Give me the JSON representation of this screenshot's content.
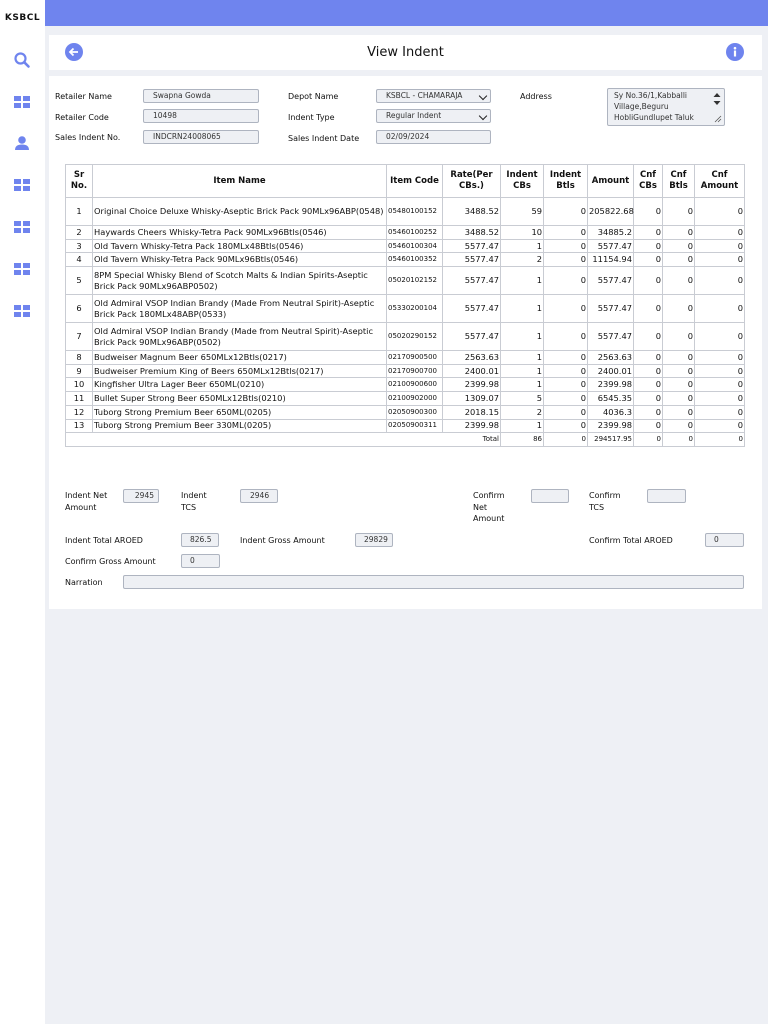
{
  "app": {
    "brand": "KSBCL"
  },
  "sidebar": {
    "items": [
      {
        "icon": "search-icon"
      },
      {
        "icon": "dashboard-icon"
      },
      {
        "icon": "user-icon"
      },
      {
        "icon": "dashboard-icon"
      },
      {
        "icon": "dashboard-icon"
      },
      {
        "icon": "dashboard-icon"
      },
      {
        "icon": "dashboard-icon"
      }
    ]
  },
  "header": {
    "title": "View Indent",
    "accent_color": "#6f84ee"
  },
  "form": {
    "retailer_name_label": "Retailer Name",
    "retailer_name": "Swapna Gowda",
    "retailer_code_label": "Retailer Code",
    "retailer_code": "10498",
    "sales_indent_no_label": "Sales Indent No.",
    "sales_indent_no": "INDCRN24008065",
    "depot_name_label": "Depot Name",
    "depot_name": "KSBCL - CHAMARAJA",
    "indent_type_label": "Indent Type",
    "indent_type": "Regular Indent",
    "sales_indent_date_label": "Sales Indent Date",
    "sales_indent_date": "02/09/2024",
    "address_label": "Address",
    "address": "Sy No.36/1,Kabballi Village,Beguru HobliGundlupet Taluk"
  },
  "table": {
    "headers": {
      "sr": "Sr No.",
      "item_name": "Item Name",
      "item_code": "Item Code",
      "rate": "Rate(Per CBs.)",
      "indent_cbs": "Indent CBs",
      "indent_btls": "Indent Btls",
      "amount": "Amount",
      "cnf_cbs": "Cnf CBs",
      "cnf_btls": "Cnf Btls",
      "cnf_amount": "Cnf Amount"
    },
    "rows": [
      {
        "sr": "1",
        "name": "Original Choice Deluxe Whisky-Aseptic Brick Pack 90MLx96ABP(0548)",
        "code": "05480100152",
        "rate": "3488.52",
        "cbs": "59",
        "btls": "0",
        "amount": "205822.68",
        "cnf_cbs": "0",
        "cnf_btls": "0",
        "cnf_amount": "0"
      },
      {
        "sr": "2",
        "name": "Haywards Cheers Whisky-Tetra Pack 90MLx96Btls(0546)",
        "code": "05460100252",
        "rate": "3488.52",
        "cbs": "10",
        "btls": "0",
        "amount": "34885.2",
        "cnf_cbs": "0",
        "cnf_btls": "0",
        "cnf_amount": "0"
      },
      {
        "sr": "3",
        "name": "Old Tavern Whisky-Tetra Pack 180MLx48Btls(0546)",
        "code": "05460100304",
        "rate": "5577.47",
        "cbs": "1",
        "btls": "0",
        "amount": "5577.47",
        "cnf_cbs": "0",
        "cnf_btls": "0",
        "cnf_amount": "0"
      },
      {
        "sr": "4",
        "name": "Old Tavern Whisky-Tetra Pack 90MLx96Btls(0546)",
        "code": "05460100352",
        "rate": "5577.47",
        "cbs": "2",
        "btls": "0",
        "amount": "11154.94",
        "cnf_cbs": "0",
        "cnf_btls": "0",
        "cnf_amount": "0"
      },
      {
        "sr": "5",
        "name": "8PM Special Whisky Blend of Scotch Malts & Indian Spirits-Aseptic Brick Pack 90MLx96ABP0502)",
        "code": "05020102152",
        "rate": "5577.47",
        "cbs": "1",
        "btls": "0",
        "amount": "5577.47",
        "cnf_cbs": "0",
        "cnf_btls": "0",
        "cnf_amount": "0"
      },
      {
        "sr": "6",
        "name": "Old Admiral VSOP Indian Brandy (Made From Neutral Spirit)-Aseptic Brick Pack 180MLx48ABP(0533)",
        "code": "05330200104",
        "rate": "5577.47",
        "cbs": "1",
        "btls": "0",
        "amount": "5577.47",
        "cnf_cbs": "0",
        "cnf_btls": "0",
        "cnf_amount": "0"
      },
      {
        "sr": "7",
        "name": "Old Admiral VSOP Indian Brandy (Made from Neutral Spirit)-Aseptic Brick Pack 90MLx96ABP(0502)",
        "code": "05020290152",
        "rate": "5577.47",
        "cbs": "1",
        "btls": "0",
        "amount": "5577.47",
        "cnf_cbs": "0",
        "cnf_btls": "0",
        "cnf_amount": "0"
      },
      {
        "sr": "8",
        "name": "Budweiser Magnum Beer 650MLx12Btls(0217)",
        "code": "02170900500",
        "rate": "2563.63",
        "cbs": "1",
        "btls": "0",
        "amount": "2563.63",
        "cnf_cbs": "0",
        "cnf_btls": "0",
        "cnf_amount": "0"
      },
      {
        "sr": "9",
        "name": "Budweiser Premium King of Beers 650MLx12Btls(0217)",
        "code": "02170900700",
        "rate": "2400.01",
        "cbs": "1",
        "btls": "0",
        "amount": "2400.01",
        "cnf_cbs": "0",
        "cnf_btls": "0",
        "cnf_amount": "0"
      },
      {
        "sr": "10",
        "name": "Kingfisher Ultra Lager Beer 650ML(0210)",
        "code": "02100900600",
        "rate": "2399.98",
        "cbs": "1",
        "btls": "0",
        "amount": "2399.98",
        "cnf_cbs": "0",
        "cnf_btls": "0",
        "cnf_amount": "0"
      },
      {
        "sr": "11",
        "name": "Bullet Super Strong Beer 650MLx12Btls(0210)",
        "code": "02100902000",
        "rate": "1309.07",
        "cbs": "5",
        "btls": "0",
        "amount": "6545.35",
        "cnf_cbs": "0",
        "cnf_btls": "0",
        "cnf_amount": "0"
      },
      {
        "sr": "12",
        "name": "Tuborg Strong Premium Beer 650ML(0205)",
        "code": "02050900300",
        "rate": "2018.15",
        "cbs": "2",
        "btls": "0",
        "amount": "4036.3",
        "cnf_cbs": "0",
        "cnf_btls": "0",
        "cnf_amount": "0"
      },
      {
        "sr": "13",
        "name": "Tuborg Strong Premium Beer 330ML(0205)",
        "code": "02050900311",
        "rate": "2399.98",
        "cbs": "1",
        "btls": "0",
        "amount": "2399.98",
        "cnf_cbs": "0",
        "cnf_btls": "0",
        "cnf_amount": "0"
      }
    ],
    "total": {
      "label": "Total",
      "cbs": "86",
      "btls": "0",
      "amount": "294517.95",
      "cnf_cbs": "0",
      "cnf_btls": "0",
      "cnf_amount": "0"
    }
  },
  "summary": {
    "indent_net_amount_label": "Indent Net Amount",
    "indent_net_amount": "2945",
    "indent_tcs_label": "Indent TCS",
    "indent_tcs": "2946",
    "confirm_net_amount_label": "Confirm Net Amount",
    "confirm_net_amount": "",
    "confirm_tcs_label": "Confirm TCS",
    "confirm_tcs": "",
    "indent_total_aroed_label": "Indent Total AROED",
    "indent_total_aroed": "826.5",
    "indent_gross_amount_label": "Indent Gross Amount",
    "indent_gross_amount": "29829",
    "confirm_total_aroed_label": "Confirm Total AROED",
    "confirm_total_aroed": "0",
    "confirm_gross_amount_label": "Confirm Gross Amount",
    "confirm_gross_amount": "0",
    "narration_label": "Narration",
    "narration": ""
  }
}
